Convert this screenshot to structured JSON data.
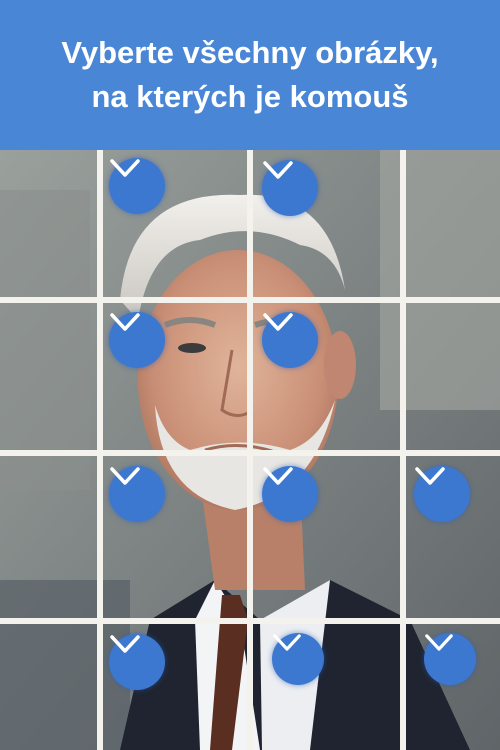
{
  "header": {
    "line1": "Vyberte všechny obrázky,",
    "line2": "na kterých je komouš"
  },
  "colors": {
    "header_bg": "#4a86d6",
    "check_bg": "#3c78d0",
    "grid_line": "#f4f2ec"
  },
  "grid": {
    "rows": 4,
    "cols": 4
  },
  "tiles": [
    {
      "row": 1,
      "col": 1,
      "selected": false
    },
    {
      "row": 1,
      "col": 2,
      "selected": true,
      "icon": "checkmark-icon"
    },
    {
      "row": 1,
      "col": 3,
      "selected": true,
      "icon": "checkmark-icon"
    },
    {
      "row": 1,
      "col": 4,
      "selected": false
    },
    {
      "row": 2,
      "col": 1,
      "selected": false
    },
    {
      "row": 2,
      "col": 2,
      "selected": true,
      "icon": "checkmark-icon"
    },
    {
      "row": 2,
      "col": 3,
      "selected": true,
      "icon": "checkmark-icon"
    },
    {
      "row": 2,
      "col": 4,
      "selected": false
    },
    {
      "row": 3,
      "col": 1,
      "selected": false
    },
    {
      "row": 3,
      "col": 2,
      "selected": true,
      "icon": "checkmark-icon"
    },
    {
      "row": 3,
      "col": 3,
      "selected": true,
      "icon": "checkmark-icon"
    },
    {
      "row": 3,
      "col": 4,
      "selected": true,
      "icon": "checkmark-icon"
    },
    {
      "row": 4,
      "col": 1,
      "selected": false
    },
    {
      "row": 4,
      "col": 2,
      "selected": true,
      "icon": "checkmark-icon"
    },
    {
      "row": 4,
      "col": 3,
      "selected": true,
      "icon": "checkmark-icon"
    },
    {
      "row": 4,
      "col": 4,
      "selected": true,
      "icon": "checkmark-icon"
    }
  ]
}
